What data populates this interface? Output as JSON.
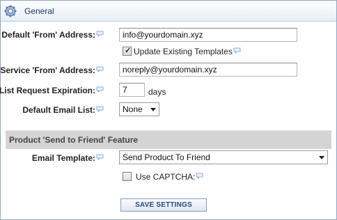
{
  "header": {
    "title": "General",
    "icon": "gear-icon"
  },
  "fields": {
    "default_from": {
      "label": "Default 'From' Address:",
      "value": "info@yourdomain.xyz"
    },
    "update_existing": {
      "label": "Update Existing Templates",
      "checked": true
    },
    "service_from": {
      "label": "Service 'From' Address:",
      "value": "noreply@yourdomain.xyz"
    },
    "list_expiration": {
      "label": "List Request Expiration:",
      "value": "7",
      "unit": "days"
    },
    "default_list": {
      "label": "Default Email List:",
      "value": "None"
    }
  },
  "section": {
    "title": "Product 'Send to Friend' Feature"
  },
  "friend": {
    "email_template": {
      "label": "Email Template:",
      "value": "Send Product To Friend"
    },
    "captcha": {
      "label": "Use CAPTCHA:",
      "checked": false
    }
  },
  "actions": {
    "save_label": "SAVE SETTINGS"
  },
  "colors": {
    "border": "#8fa6c4",
    "section_bg": "#d4d4d4",
    "button_text": "#244a82"
  }
}
